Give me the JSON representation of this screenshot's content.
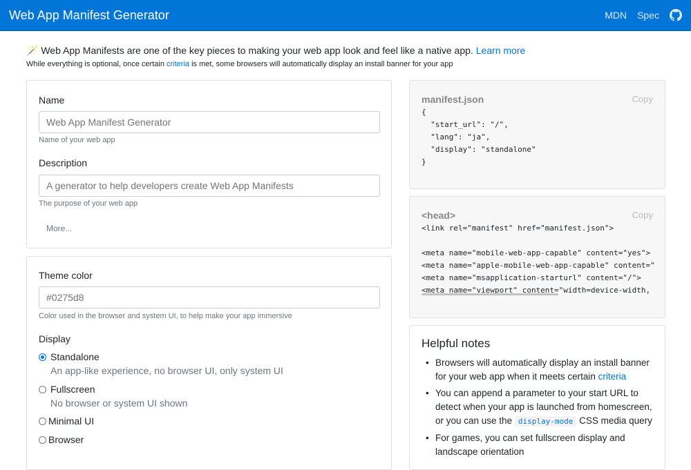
{
  "navbar": {
    "title": "Web App Manifest Generator",
    "links": [
      "MDN",
      "Spec"
    ],
    "github_icon": "github-icon"
  },
  "intro": {
    "wand": "🪄",
    "text": "Web App Manifests are one of the key pieces to making your web app look and feel like a native app.",
    "learn_more": "Learn more",
    "sub_before": "While everything is optional, once certain",
    "sub_link": "criteria",
    "sub_after": "is met, some browsers will automatically display an install banner for your app"
  },
  "form1": {
    "name_label": "Name",
    "name_placeholder": "Web App Manifest Generator",
    "name_help": "Name of your web app",
    "desc_label": "Description",
    "desc_placeholder": "A generator to help developers create Web App Manifests",
    "desc_help": "The purpose of your web app",
    "more": "More..."
  },
  "form2": {
    "theme_label": "Theme color",
    "theme_placeholder": "#0275d8",
    "theme_help": "Color used in the browser and system UI, to help make your app immersive",
    "display_label": "Display",
    "options": [
      {
        "label": "Standalone",
        "desc": "An app-like experience, no browser UI, only system UI",
        "checked": true
      },
      {
        "label": "Fullscreen",
        "desc": "No browser or system UI shown",
        "checked": false
      },
      {
        "label": "Minimal UI",
        "desc": "",
        "checked": false
      },
      {
        "label": "Browser",
        "desc": "",
        "checked": false
      }
    ]
  },
  "manifest": {
    "title": "manifest.json",
    "copy": "Copy",
    "code": "{\n  \"start_url\": \"/\",\n  \"lang\": \"ja\",\n  \"display\": \"standalone\"\n}"
  },
  "head": {
    "title": "<head>",
    "copy": "Copy",
    "code": "<link rel=\"manifest\" href=\"manifest.json\">\n\n<meta name=\"mobile-web-app-capable\" content=\"yes\">\n<meta name=\"apple-mobile-web-app-capable\" content=\"\n<meta name=\"msapplication-starturl\" content=\"/\">\n<meta name=\"viewport\" content=\"width=device-width,"
  },
  "notes": {
    "title": "Helpful notes",
    "n1_text": "Browsers will automatically display an install banner for your web app when it meets certain",
    "n1_link": "criteria",
    "n2_before": "You can append a parameter to your start URL to detect when your app is launched from homescreen, or you can use the",
    "n2_code": "display-mode",
    "n2_after": "CSS media query",
    "n3_text": "For games, you can set fullscreen display and landscape orientation"
  },
  "colors": {
    "accent": "#0275d8",
    "navbar": "#0275d8"
  }
}
